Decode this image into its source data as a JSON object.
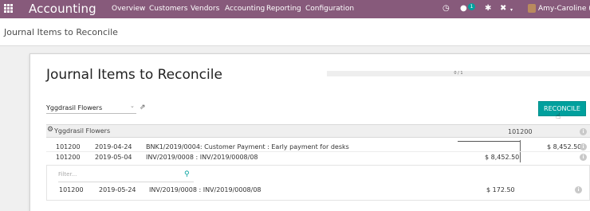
{
  "navbar": {
    "app_title": "Accounting",
    "menu": [
      "Overview",
      "Customers",
      "Vendors",
      "Accounting",
      "Reporting",
      "Configuration"
    ],
    "chat_badge": "1",
    "user": "Amy-Caroline (sta"
  },
  "breadcrumb": "Journal Items to Reconcile",
  "page": {
    "title": "Journal Items to Reconcile",
    "progress": "0 / 1",
    "progress_fraction": 0
  },
  "partner_select": {
    "value": "Yggdrasil Flowers"
  },
  "reconcile_button": "RECONCILE",
  "reconciliation": {
    "partner": "Yggdrasil Flowers",
    "account": "101200",
    "lines": [
      {
        "account": "101200",
        "date": "2019-04-24",
        "label": "BNK1/2019/0004: Customer Payment : Early payment for desks",
        "debit": "",
        "credit": "$ 8,452.50"
      },
      {
        "account": "101200",
        "date": "2019-05-04",
        "label": "INV/2019/0008 : INV/2019/0008/08",
        "debit": "$ 8,452.50",
        "credit": ""
      }
    ],
    "filter_placeholder": "Filter...",
    "proposition_lines": [
      {
        "account": "101200",
        "date": "2019-05-24",
        "label": "INV/2019/0008 : INV/2019/0008/08",
        "debit": "$ 172.50",
        "credit": ""
      }
    ]
  },
  "colors": {
    "brand": "#875a7b",
    "accent": "#00a09d"
  },
  "icons": [
    "apps-grid-icon",
    "clock-icon",
    "chat-icon",
    "bug-icon",
    "tools-icon",
    "avatar",
    "external-link-icon",
    "gear-icon",
    "info-icon",
    "search-icon"
  ]
}
